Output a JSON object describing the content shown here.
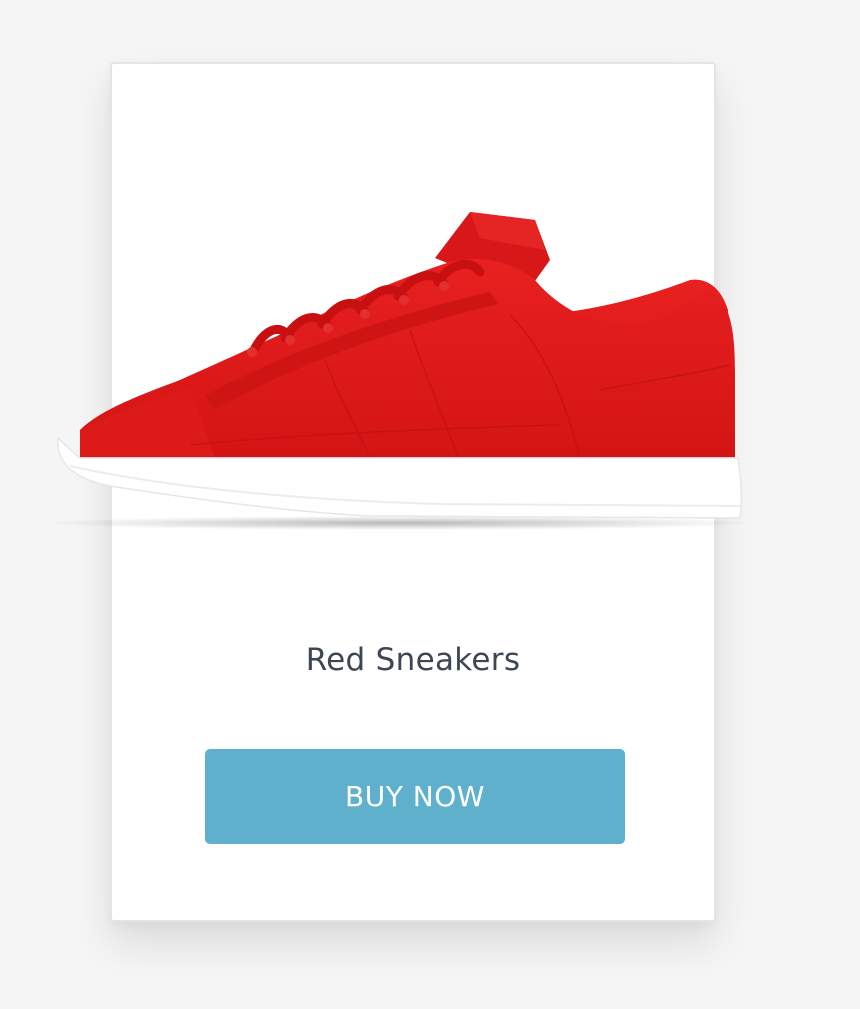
{
  "product": {
    "name": "Red Sneakers",
    "image_icon": "red-sneaker-image",
    "shoe_color": "#e31b1b",
    "sole_color": "#ffffff"
  },
  "actions": {
    "buy_label": "BUY NOW",
    "buy_color": "#5fb0cc"
  },
  "colors": {
    "background": "#f5f5f6",
    "card": "#ffffff",
    "text": "#3d4655"
  }
}
